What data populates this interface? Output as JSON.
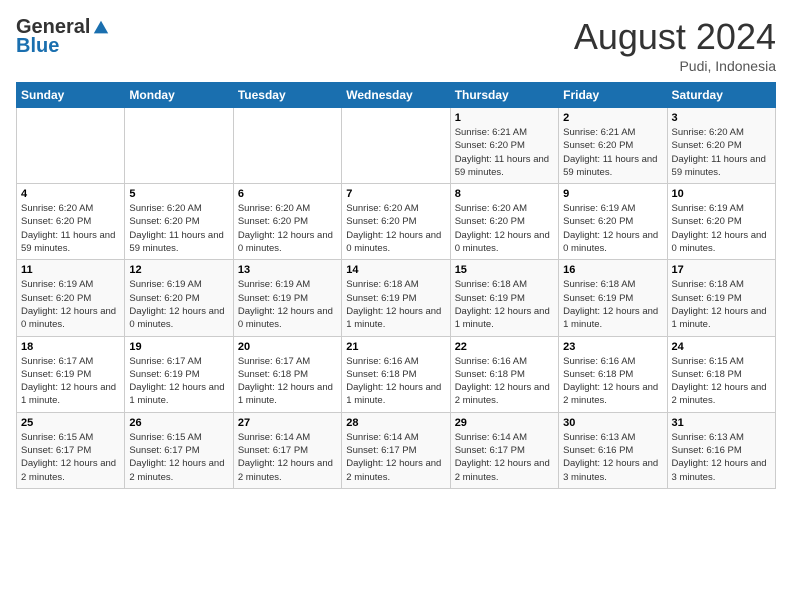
{
  "logo": {
    "general": "General",
    "blue": "Blue"
  },
  "header": {
    "title": "August 2024",
    "subtitle": "Pudi, Indonesia"
  },
  "weekdays": [
    "Sunday",
    "Monday",
    "Tuesday",
    "Wednesday",
    "Thursday",
    "Friday",
    "Saturday"
  ],
  "weeks": [
    [
      {
        "day": "",
        "sunrise": "",
        "sunset": "",
        "daylight": ""
      },
      {
        "day": "",
        "sunrise": "",
        "sunset": "",
        "daylight": ""
      },
      {
        "day": "",
        "sunrise": "",
        "sunset": "",
        "daylight": ""
      },
      {
        "day": "",
        "sunrise": "",
        "sunset": "",
        "daylight": ""
      },
      {
        "day": "1",
        "sunrise": "Sunrise: 6:21 AM",
        "sunset": "Sunset: 6:20 PM",
        "daylight": "Daylight: 11 hours and 59 minutes."
      },
      {
        "day": "2",
        "sunrise": "Sunrise: 6:21 AM",
        "sunset": "Sunset: 6:20 PM",
        "daylight": "Daylight: 11 hours and 59 minutes."
      },
      {
        "day": "3",
        "sunrise": "Sunrise: 6:20 AM",
        "sunset": "Sunset: 6:20 PM",
        "daylight": "Daylight: 11 hours and 59 minutes."
      }
    ],
    [
      {
        "day": "4",
        "sunrise": "Sunrise: 6:20 AM",
        "sunset": "Sunset: 6:20 PM",
        "daylight": "Daylight: 11 hours and 59 minutes."
      },
      {
        "day": "5",
        "sunrise": "Sunrise: 6:20 AM",
        "sunset": "Sunset: 6:20 PM",
        "daylight": "Daylight: 11 hours and 59 minutes."
      },
      {
        "day": "6",
        "sunrise": "Sunrise: 6:20 AM",
        "sunset": "Sunset: 6:20 PM",
        "daylight": "Daylight: 12 hours and 0 minutes."
      },
      {
        "day": "7",
        "sunrise": "Sunrise: 6:20 AM",
        "sunset": "Sunset: 6:20 PM",
        "daylight": "Daylight: 12 hours and 0 minutes."
      },
      {
        "day": "8",
        "sunrise": "Sunrise: 6:20 AM",
        "sunset": "Sunset: 6:20 PM",
        "daylight": "Daylight: 12 hours and 0 minutes."
      },
      {
        "day": "9",
        "sunrise": "Sunrise: 6:19 AM",
        "sunset": "Sunset: 6:20 PM",
        "daylight": "Daylight: 12 hours and 0 minutes."
      },
      {
        "day": "10",
        "sunrise": "Sunrise: 6:19 AM",
        "sunset": "Sunset: 6:20 PM",
        "daylight": "Daylight: 12 hours and 0 minutes."
      }
    ],
    [
      {
        "day": "11",
        "sunrise": "Sunrise: 6:19 AM",
        "sunset": "Sunset: 6:20 PM",
        "daylight": "Daylight: 12 hours and 0 minutes."
      },
      {
        "day": "12",
        "sunrise": "Sunrise: 6:19 AM",
        "sunset": "Sunset: 6:20 PM",
        "daylight": "Daylight: 12 hours and 0 minutes."
      },
      {
        "day": "13",
        "sunrise": "Sunrise: 6:19 AM",
        "sunset": "Sunset: 6:19 PM",
        "daylight": "Daylight: 12 hours and 0 minutes."
      },
      {
        "day": "14",
        "sunrise": "Sunrise: 6:18 AM",
        "sunset": "Sunset: 6:19 PM",
        "daylight": "Daylight: 12 hours and 1 minute."
      },
      {
        "day": "15",
        "sunrise": "Sunrise: 6:18 AM",
        "sunset": "Sunset: 6:19 PM",
        "daylight": "Daylight: 12 hours and 1 minute."
      },
      {
        "day": "16",
        "sunrise": "Sunrise: 6:18 AM",
        "sunset": "Sunset: 6:19 PM",
        "daylight": "Daylight: 12 hours and 1 minute."
      },
      {
        "day": "17",
        "sunrise": "Sunrise: 6:18 AM",
        "sunset": "Sunset: 6:19 PM",
        "daylight": "Daylight: 12 hours and 1 minute."
      }
    ],
    [
      {
        "day": "18",
        "sunrise": "Sunrise: 6:17 AM",
        "sunset": "Sunset: 6:19 PM",
        "daylight": "Daylight: 12 hours and 1 minute."
      },
      {
        "day": "19",
        "sunrise": "Sunrise: 6:17 AM",
        "sunset": "Sunset: 6:19 PM",
        "daylight": "Daylight: 12 hours and 1 minute."
      },
      {
        "day": "20",
        "sunrise": "Sunrise: 6:17 AM",
        "sunset": "Sunset: 6:18 PM",
        "daylight": "Daylight: 12 hours and 1 minute."
      },
      {
        "day": "21",
        "sunrise": "Sunrise: 6:16 AM",
        "sunset": "Sunset: 6:18 PM",
        "daylight": "Daylight: 12 hours and 1 minute."
      },
      {
        "day": "22",
        "sunrise": "Sunrise: 6:16 AM",
        "sunset": "Sunset: 6:18 PM",
        "daylight": "Daylight: 12 hours and 2 minutes."
      },
      {
        "day": "23",
        "sunrise": "Sunrise: 6:16 AM",
        "sunset": "Sunset: 6:18 PM",
        "daylight": "Daylight: 12 hours and 2 minutes."
      },
      {
        "day": "24",
        "sunrise": "Sunrise: 6:15 AM",
        "sunset": "Sunset: 6:18 PM",
        "daylight": "Daylight: 12 hours and 2 minutes."
      }
    ],
    [
      {
        "day": "25",
        "sunrise": "Sunrise: 6:15 AM",
        "sunset": "Sunset: 6:17 PM",
        "daylight": "Daylight: 12 hours and 2 minutes."
      },
      {
        "day": "26",
        "sunrise": "Sunrise: 6:15 AM",
        "sunset": "Sunset: 6:17 PM",
        "daylight": "Daylight: 12 hours and 2 minutes."
      },
      {
        "day": "27",
        "sunrise": "Sunrise: 6:14 AM",
        "sunset": "Sunset: 6:17 PM",
        "daylight": "Daylight: 12 hours and 2 minutes."
      },
      {
        "day": "28",
        "sunrise": "Sunrise: 6:14 AM",
        "sunset": "Sunset: 6:17 PM",
        "daylight": "Daylight: 12 hours and 2 minutes."
      },
      {
        "day": "29",
        "sunrise": "Sunrise: 6:14 AM",
        "sunset": "Sunset: 6:17 PM",
        "daylight": "Daylight: 12 hours and 2 minutes."
      },
      {
        "day": "30",
        "sunrise": "Sunrise: 6:13 AM",
        "sunset": "Sunset: 6:16 PM",
        "daylight": "Daylight: 12 hours and 3 minutes."
      },
      {
        "day": "31",
        "sunrise": "Sunrise: 6:13 AM",
        "sunset": "Sunset: 6:16 PM",
        "daylight": "Daylight: 12 hours and 3 minutes."
      }
    ]
  ]
}
